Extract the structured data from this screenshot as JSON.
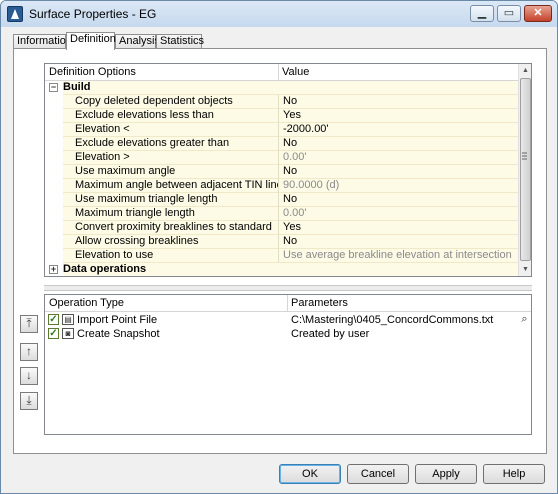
{
  "window": {
    "title": "Surface Properties - EG",
    "controls": {
      "minimize": "▁",
      "maximize": "▭",
      "close": "✕"
    }
  },
  "tabs": [
    {
      "label": "Information",
      "active": false
    },
    {
      "label": "Definition",
      "active": true
    },
    {
      "label": "Analysis",
      "active": false
    },
    {
      "label": "Statistics",
      "active": false
    }
  ],
  "definition_grid": {
    "col_option": "Definition Options",
    "col_value": "Value",
    "build": {
      "label": "Build",
      "expander": "−",
      "rows": [
        {
          "option": "Copy deleted dependent objects",
          "value": "No"
        },
        {
          "option": "Exclude elevations less than",
          "value": "Yes"
        },
        {
          "option": "Elevation <",
          "value": "-2000.00'"
        },
        {
          "option": "Exclude elevations greater than",
          "value": "No"
        },
        {
          "option": "Elevation >",
          "value": "0.00'"
        },
        {
          "option": "Use maximum angle",
          "value": "No"
        },
        {
          "option": "Maximum angle between adjacent TIN lines",
          "value": "90.0000 (d)"
        },
        {
          "option": "Use maximum triangle length",
          "value": "No"
        },
        {
          "option": "Maximum triangle length",
          "value": "0.00'"
        },
        {
          "option": "Convert proximity breaklines to standard",
          "value": "Yes"
        },
        {
          "option": "Allow crossing breaklines",
          "value": "No"
        },
        {
          "option": "Elevation to use",
          "value": "Use average breakline elevation at intersection"
        }
      ]
    },
    "data_operations": {
      "label": "Data operations",
      "expander": "+"
    }
  },
  "operations": {
    "col_type": "Operation Type",
    "col_params": "Parameters",
    "rows": [
      {
        "name": "Import Point File",
        "param": "C:\\Mastering\\0405_ConcordCommons.txt",
        "checked": true
      },
      {
        "name": "Create Snapshot",
        "param": "Created by user",
        "checked": true
      }
    ],
    "check_glyph": "✓"
  },
  "move_buttons": [
    "⤒",
    "↑",
    "↓",
    "⤓"
  ],
  "buttons": {
    "ok": "OK",
    "cancel": "Cancel",
    "apply": "Apply",
    "help": "Help"
  }
}
